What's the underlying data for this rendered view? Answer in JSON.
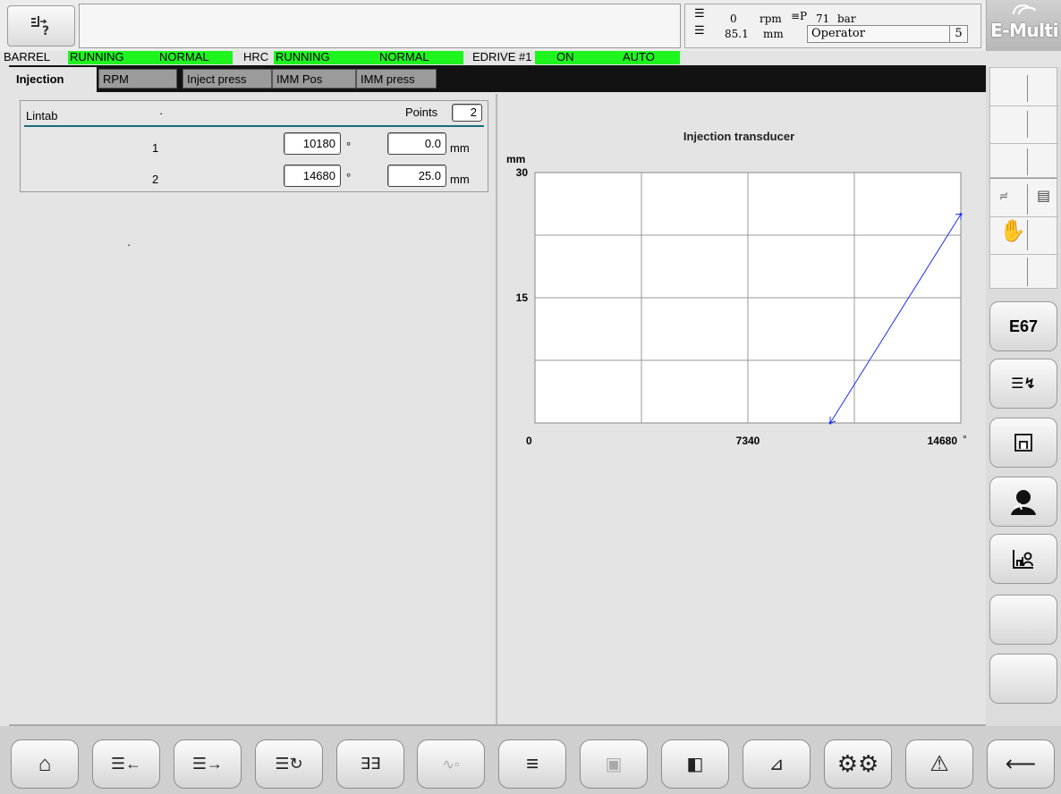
{
  "header": {
    "rpm_value": "0",
    "rpm_unit": "rpm",
    "pressure_value": "71",
    "pressure_unit": "bar",
    "position_value": "85.1",
    "position_unit": "mm",
    "user_role": "Operator",
    "user_level": "5",
    "logo": "E-Multi"
  },
  "status_strip": {
    "barrel_label": "BARREL",
    "barrel_state": "RUNNING",
    "barrel_mode": "NORMAL",
    "hrc_label": "HRC",
    "hrc_state": "RUNNING",
    "hrc_mode": "NORMAL",
    "edrive_label": "EDRIVE #1",
    "edrive_state": "ON",
    "edrive_mode": "AUTO"
  },
  "tabs": [
    {
      "label": "Injection",
      "active": true
    },
    {
      "label": "RPM",
      "active": false
    },
    {
      "label": "Inject press",
      "active": false
    },
    {
      "label": "IMM Pos",
      "active": false
    },
    {
      "label": "IMM press",
      "active": false
    }
  ],
  "lintab": {
    "title": "Lintab",
    "dot": "·",
    "points_label": "Points",
    "points_value": "2",
    "rows": [
      {
        "index": "1",
        "angle": "10180",
        "angle_unit": "°",
        "distance": "0.0",
        "distance_unit": "mm"
      },
      {
        "index": "2",
        "angle": "14680",
        "angle_unit": "°",
        "distance": "25.0",
        "distance_unit": "mm"
      }
    ],
    "stray_dot": "·"
  },
  "chart_data": {
    "type": "line",
    "title": "Injection transducer",
    "ylabel": "mm",
    "xlabel": "",
    "x_unit": "°",
    "xlim": [
      0,
      14680
    ],
    "ylim": [
      0,
      30
    ],
    "x_ticks": [
      "0",
      "7340",
      "14680"
    ],
    "y_ticks": [
      "30",
      "15"
    ],
    "grid": true,
    "series": [
      {
        "values": [
          [
            10180,
            0.0
          ],
          [
            14680,
            25.0
          ]
        ],
        "color": "#1a2fff"
      }
    ]
  },
  "right_sidebar": {
    "e67_label": "E67",
    "icons": [
      "conveyor-icon",
      "list-icon",
      "hand-icon",
      "screw-settings-icon",
      "save-icon",
      "operator-icon",
      "chart-user-icon"
    ]
  },
  "bottom_bar": {
    "buttons": [
      "home-icon",
      "screw-back-icon",
      "screw-inject-icon",
      "screw-rotate-icon",
      "heater-icon",
      "temperature-profile-icon",
      "menu-list-icon",
      "mold-icon",
      "ejector-icon",
      "graph-icon",
      "settings-gears-icon",
      "warning-icon",
      "back-arrow-icon"
    ]
  },
  "colors": {
    "status_green": "#1ef41e",
    "chart_line": "#1a2fff",
    "tab_bar": "#121212"
  }
}
